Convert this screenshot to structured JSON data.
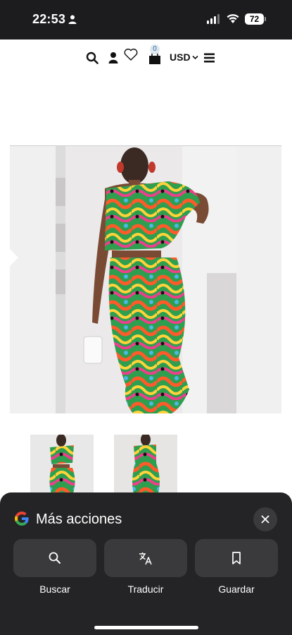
{
  "status_bar": {
    "time": "22:53",
    "battery": "72",
    "person_icon": "person-icon",
    "signal_icon": "cellular-signal-icon",
    "wifi_icon": "wifi-icon"
  },
  "nav": {
    "search_icon": "search-icon",
    "account_icon": "user-icon",
    "wishlist_icon": "heart-icon",
    "cart_icon": "cart-icon",
    "cart_count": "0",
    "currency": "USD",
    "menu_icon": "hamburger-menu-icon"
  },
  "sheet": {
    "title": "Más acciones",
    "actions": [
      {
        "label": "Buscar",
        "icon": "search-icon"
      },
      {
        "label": "Traducir",
        "icon": "translate-icon"
      },
      {
        "label": "Guardar",
        "icon": "bookmark-icon"
      }
    ]
  },
  "colors": {
    "status_bg": "#1c1c1e",
    "sheet_bg": "#242426",
    "button_bg": "#3a3a3c",
    "page_bg": "#ffffff"
  }
}
